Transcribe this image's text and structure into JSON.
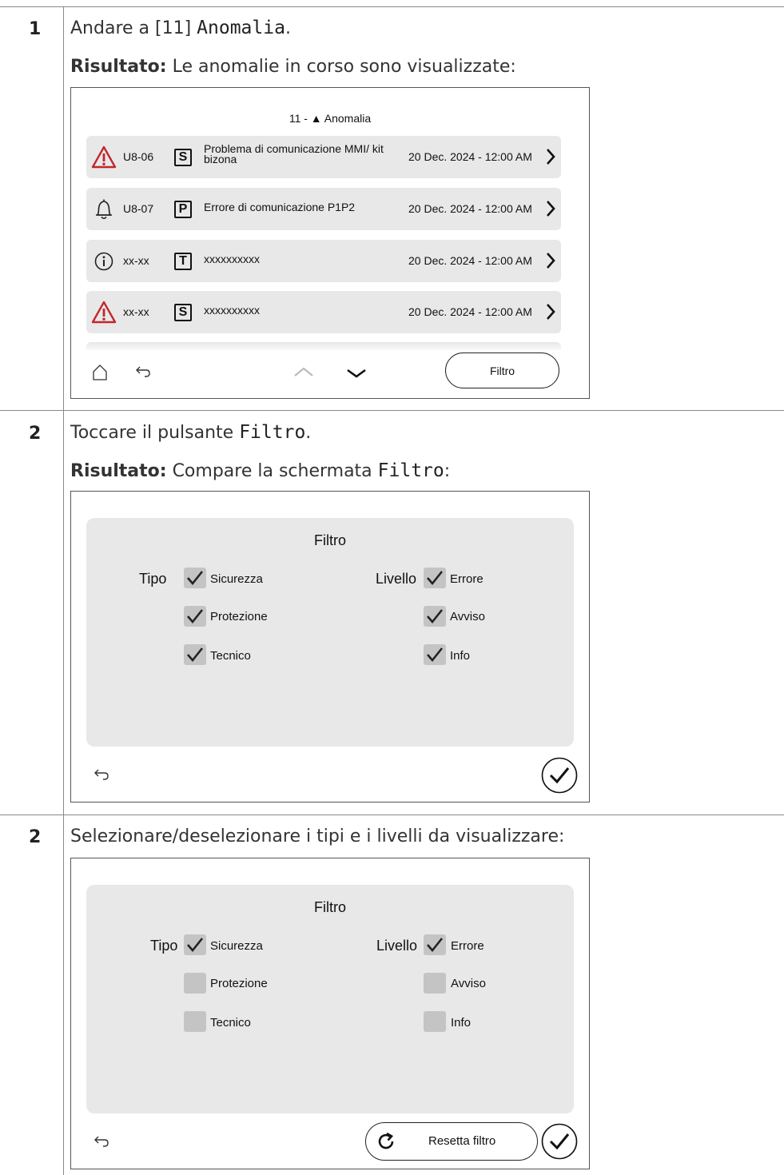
{
  "steps": [
    {
      "number": "1",
      "instruction_text": "Andare a [11] ",
      "instruction_code": "Anomalia",
      "instruction_end": ".",
      "result_label": "Risultato:",
      "result_text": " Le anomalie in corso sono visualizzate:"
    },
    {
      "number": "2",
      "instruction_text": "Toccare il pulsante ",
      "instruction_code": "Filtro",
      "instruction_end": ".",
      "result_label": "Risultato:",
      "result_text": "  Compare la schermata ",
      "result_code": "Filtro",
      "result_end": ":"
    },
    {
      "number": "2",
      "instruction_text": "Selezionare/deselezionare i tipi e i livelli da visualizzare:"
    }
  ],
  "anomaly_screen": {
    "title": "11 - ▲ Anomalia",
    "rows": [
      {
        "icon": "warning-triangle-icon",
        "code": "U8-06",
        "badge": "S",
        "desc": "Problema di comunicazione MMI/ kit bizona",
        "date": "20 Dec. 2024 - 12:00 AM"
      },
      {
        "icon": "bell-icon",
        "code": "U8-07",
        "badge": "P",
        "desc": "Errore di comunicazione P1P2",
        "date": "20 Dec. 2024 - 12:00 AM"
      },
      {
        "icon": "info-circle-icon",
        "code": "xx-xx",
        "badge": "T",
        "desc": "xxxxxxxxxx",
        "date": "20 Dec. 2024 - 12:00 AM"
      },
      {
        "icon": "warning-triangle-icon",
        "code": "xx-xx",
        "badge": "S",
        "desc": "xxxxxxxxxx",
        "date": "20 Dec. 2024 - 12:00 AM"
      }
    ],
    "filter_button": "Filtro",
    "colors": {
      "warning": "#c0282d",
      "row_bg": "#e8e8e8"
    }
  },
  "filter_screen_1": {
    "title": "Filtro",
    "tipo_label": "Tipo",
    "livello_label": "Livello",
    "tipo_options": [
      {
        "label": "Sicurezza",
        "checked": true
      },
      {
        "label": "Protezione",
        "checked": true
      },
      {
        "label": "Tecnico",
        "checked": true
      }
    ],
    "livello_options": [
      {
        "label": "Errore",
        "checked": true
      },
      {
        "label": "Avviso",
        "checked": true
      },
      {
        "label": "Info",
        "checked": true
      }
    ]
  },
  "filter_screen_2": {
    "title": "Filtro",
    "tipo_label": "Tipo",
    "livello_label": "Livello",
    "tipo_options": [
      {
        "label": "Sicurezza",
        "checked": true
      },
      {
        "label": "Protezione",
        "checked": false
      },
      {
        "label": "Tecnico",
        "checked": false
      }
    ],
    "livello_options": [
      {
        "label": "Errore",
        "checked": true
      },
      {
        "label": "Avviso",
        "checked": false
      },
      {
        "label": "Info",
        "checked": false
      }
    ],
    "reset_button": "Resetta filtro"
  }
}
